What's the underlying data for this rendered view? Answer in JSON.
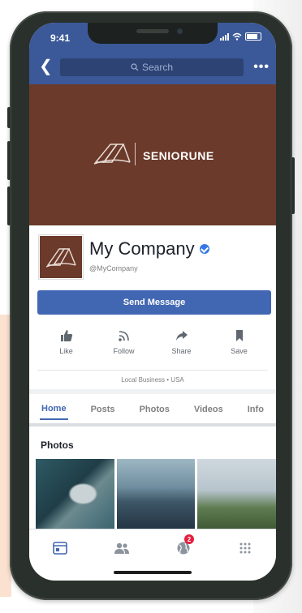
{
  "status_bar": {
    "time": "9:41"
  },
  "top_bar": {
    "search_placeholder": "Search",
    "back_icon": "back-arrow-icon",
    "more_icon": "more-dots-icon"
  },
  "cover": {
    "brand": "SENIORUNE",
    "color": "#6b3a2a"
  },
  "page": {
    "name": "My Company",
    "handle": "@MyCompany"
  },
  "send_message": {
    "label": "Send Message"
  },
  "actions": [
    {
      "label": "Like",
      "icon": "thumbs-up-icon"
    },
    {
      "label": "Follow",
      "icon": "rss-icon"
    },
    {
      "label": "Share",
      "icon": "share-arrow-icon"
    },
    {
      "label": "Save",
      "icon": "bookmark-icon"
    }
  ],
  "meta": {
    "text": "Local Business  •  USA"
  },
  "tabs": [
    {
      "label": "Home",
      "active": true
    },
    {
      "label": "Posts"
    },
    {
      "label": "Photos"
    },
    {
      "label": "Videos"
    },
    {
      "label": "Info"
    }
  ],
  "photos": {
    "title": "Photos"
  },
  "bottom_nav": {
    "notifications_badge": "2"
  },
  "colors": {
    "brand_blue": "#4267b2",
    "header_blue": "#3b5998",
    "badge_red": "#e41e3f"
  }
}
